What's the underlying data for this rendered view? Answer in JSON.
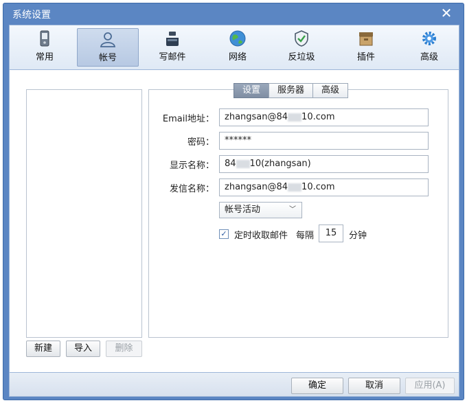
{
  "window": {
    "title": "系统设置"
  },
  "toolbar": {
    "items": [
      {
        "label": "常用",
        "icon": "phone-icon"
      },
      {
        "label": "帐号",
        "icon": "user-icon"
      },
      {
        "label": "写邮件",
        "icon": "inkwell-icon"
      },
      {
        "label": "网络",
        "icon": "globe-icon"
      },
      {
        "label": "反垃圾",
        "icon": "shield-icon"
      },
      {
        "label": "插件",
        "icon": "box-icon"
      },
      {
        "label": "高级",
        "icon": "gear-icon"
      }
    ],
    "active": "帐号"
  },
  "account_list": {
    "new_label": "新建",
    "import_label": "导入",
    "delete_label": "删除"
  },
  "tabs": [
    {
      "label": "设置",
      "active": true
    },
    {
      "label": "服务器",
      "active": false
    },
    {
      "label": "高级",
      "active": false
    }
  ],
  "form": {
    "email_label": "Email地址：",
    "email_pre": "zhangsan@84",
    "email_post": "10.com",
    "password_label": "密码：",
    "password_value": "******",
    "display_label": "显示名称：",
    "display_pre": "84",
    "display_post": "10(zhangsan)",
    "sender_label": "发信名称：",
    "sender_pre": "zhangsan@84",
    "sender_post": "10.com",
    "status_value": "帐号活动",
    "schedule_checked": true,
    "schedule_label": "定时收取邮件",
    "every_label": "每隔",
    "interval_value": "15",
    "minute_label": "分钟"
  },
  "footer": {
    "ok_label": "确定",
    "cancel_label": "取消",
    "apply_label": "应用(A)"
  },
  "colors": {
    "window_frame": "#5b86c3",
    "active_tab": "#8796aa"
  }
}
